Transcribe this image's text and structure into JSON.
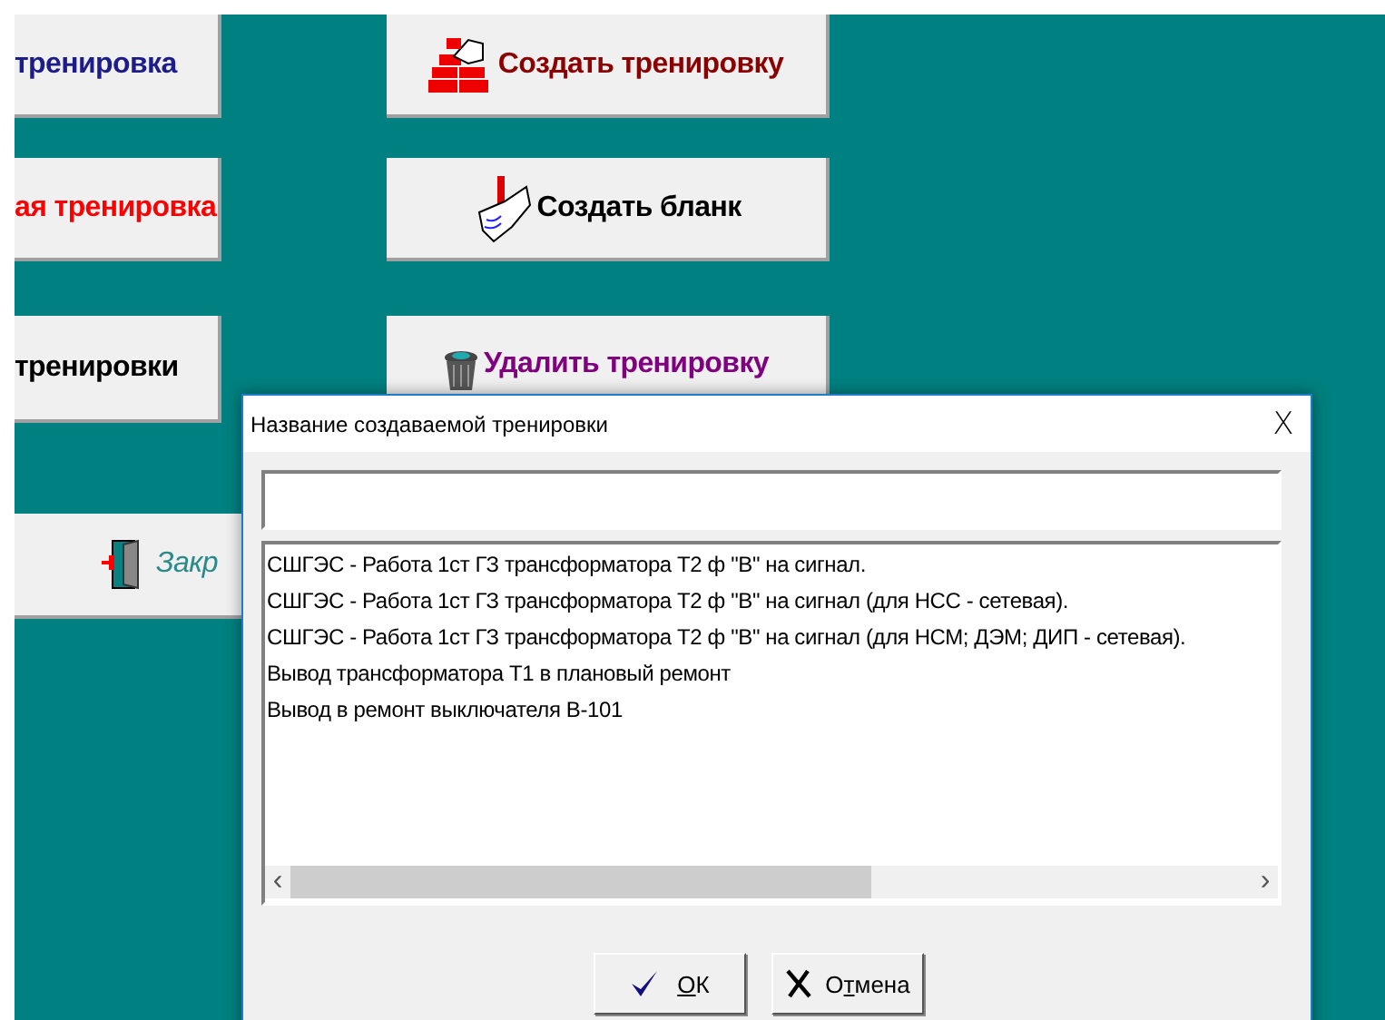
{
  "left_buttons": [
    {
      "kind": "text",
      "label": "тренировка",
      "color": "#1c1c8a"
    },
    {
      "kind": "text",
      "label": "ая тренировка",
      "color": "#ff0000"
    },
    {
      "kind": "text",
      "label": "тренировки",
      "color": "#000000"
    },
    {
      "kind": "door",
      "label": "Закр",
      "color": "#2a8a8a"
    }
  ],
  "right_buttons": [
    {
      "kind": "bricks",
      "label": "Создать тренировку",
      "color": "#8b0000"
    },
    {
      "kind": "hand",
      "label": "Создать бланк",
      "color": "#000000"
    },
    {
      "kind": "trash",
      "label": "Удалить тренировку",
      "color": "#800080"
    }
  ],
  "dialog": {
    "title": "Название создаваемой тренировки",
    "close": "X",
    "list": [
      "СШГЭС - Работа 1ст ГЗ трансформатора Т2 ф \"В\" на сигнал.",
      "СШГЭС - Работа 1ст ГЗ трансформатора Т2 ф \"В\" на сигнал (для НСС - сетевая).",
      "СШГЭС - Работа 1ст ГЗ трансформатора Т2 ф \"В\" на сигнал (для НСМ; ДЭМ; ДИП - сетевая).",
      "Вывод трансформатора Т1 в плановый ремонт",
      "Вывод в ремонт выключателя В-101"
    ],
    "scroll_left": "‹",
    "scroll_right": "›",
    "buttons": [
      {
        "kind": "ok",
        "key": "О",
        "after": "К"
      },
      {
        "kind": "cancel",
        "before": "О",
        "key": "т",
        "after": "мена"
      }
    ]
  }
}
